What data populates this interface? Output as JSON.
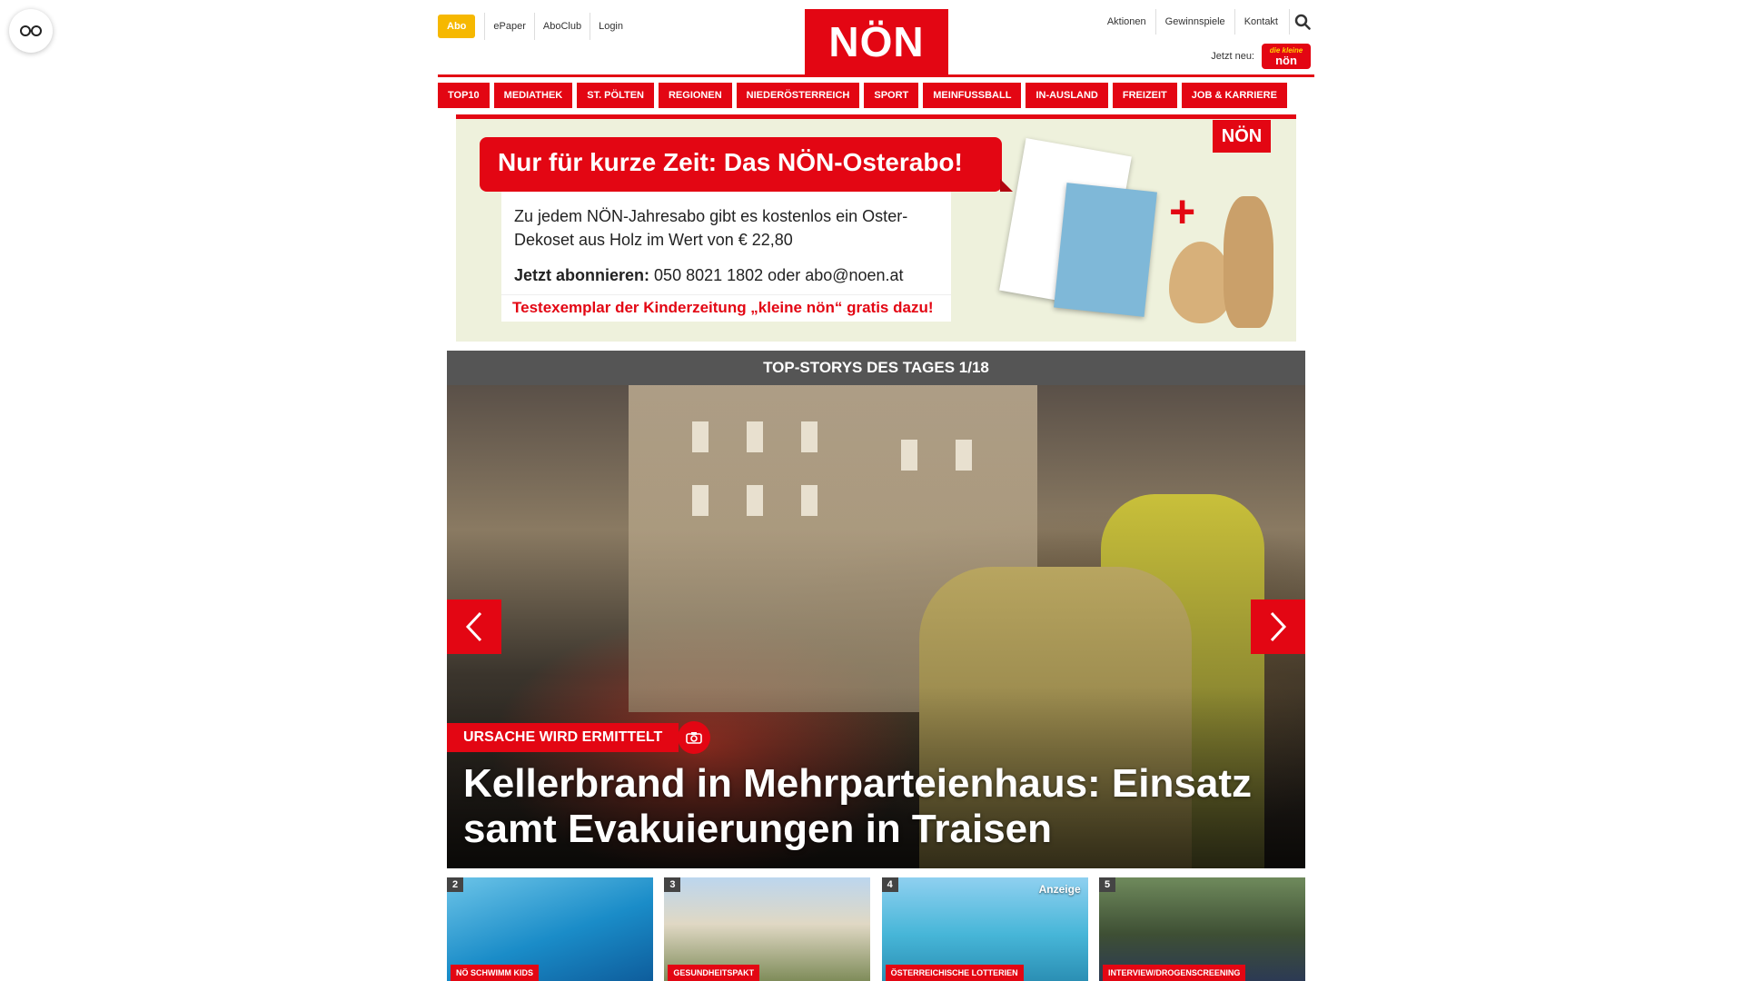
{
  "header": {
    "abo_label": "Abo",
    "top_links": [
      "ePaper",
      "AboClub",
      "Login"
    ],
    "logo_text": "NÖN",
    "right_links": [
      "Aktionen",
      "Gewinnspiele",
      "Kontakt"
    ],
    "jetzt_neu_label": "Jetzt neu:",
    "kleine_logo_top": "die kleine",
    "kleine_logo_bottom": "nön"
  },
  "nav": {
    "items": [
      "TOP10",
      "MEDIATHEK",
      "ST. PÖLTEN",
      "REGIONEN",
      "NIEDERÖSTERREICH",
      "SPORT",
      "MEINFUSSBALL",
      "IN-AUSLAND",
      "FREIZEIT",
      "JOB & KARRIERE"
    ]
  },
  "ad": {
    "headline": "Nur für kurze Zeit: Das NÖN-Osterabo!",
    "body": "Zu jedem NÖN-Jahresabo gibt es kostenlos ein Oster-Dekoset aus Holz im Wert von € 22,80",
    "contact_label": "Jetzt abonnieren:",
    "contact_value": "050 8021 1802 oder abo@noen.at",
    "free_line": "Testexemplar der Kinderzeitung „kleine nön“ gratis dazu!",
    "brand": "NÖN",
    "plus": "+"
  },
  "stories": {
    "bar_title": "TOP-STORYS DES TAGES 1/18",
    "hero_kicker": "URSACHE WIRD ERMITTELT",
    "hero_title": "Kellerbrand in Mehrparteienhaus: Einsatz samt Evakuierungen in Traisen"
  },
  "teasers": [
    {
      "num": "2",
      "tag": "NÖ SCHWIMM KIDS",
      "ad": ""
    },
    {
      "num": "3",
      "tag": "GESUNDHEITSPAKT",
      "ad": ""
    },
    {
      "num": "4",
      "tag": "ÖSTERREICHISCHE LOTTERIEN",
      "ad": "Anzeige"
    },
    {
      "num": "5",
      "tag": "INTERVIEW/DROGENSCREENING",
      "ad": ""
    }
  ],
  "colors": {
    "brand_red": "#e30613",
    "abo_yellow": "#f6b800",
    "bar_gray": "#555555"
  },
  "icons": {
    "reader": "glasses-icon",
    "search": "search-icon",
    "prev": "chevron-left-icon",
    "next": "chevron-right-icon",
    "camera": "camera-icon"
  }
}
